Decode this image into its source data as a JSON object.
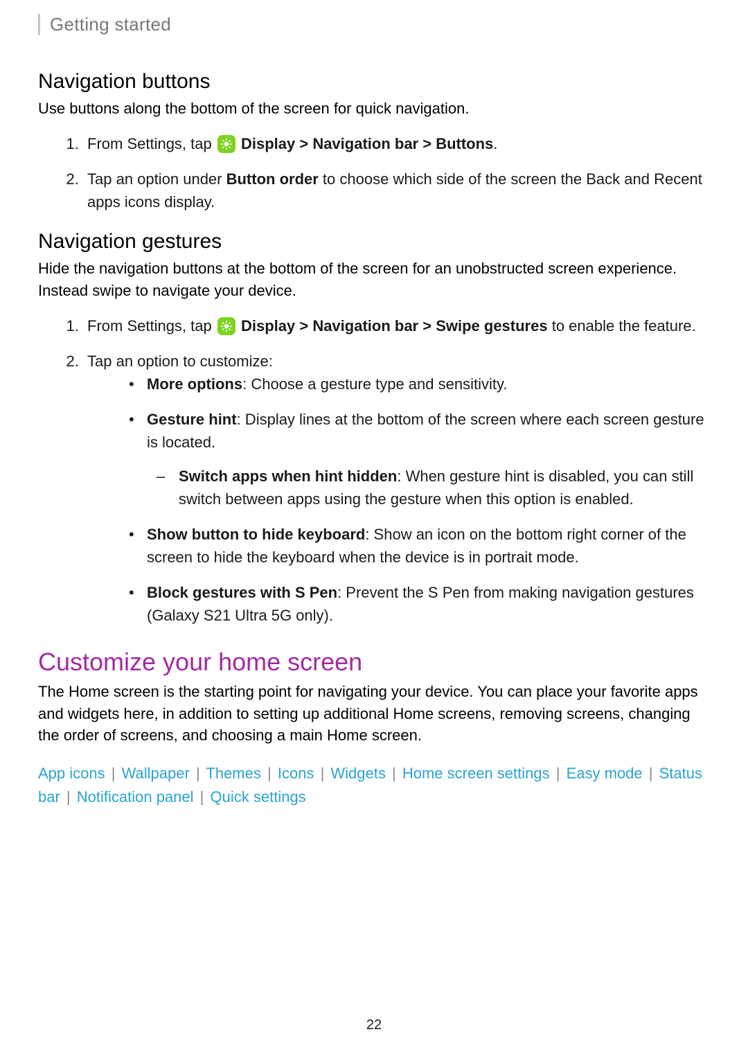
{
  "header": "Getting started",
  "nav_buttons": {
    "title": "Navigation buttons",
    "intro": "Use buttons along the bottom of the screen for quick navigation.",
    "step1_prefix": "From Settings, tap ",
    "step1_bold": "Display > Navigation bar > Buttons",
    "step1_suffix": ".",
    "step2_a": "Tap an option under ",
    "step2_bold": "Button order",
    "step2_b": " to choose which side of the screen the Back and Recent apps icons display."
  },
  "nav_gestures": {
    "title": "Navigation gestures",
    "intro": "Hide the navigation buttons at the bottom of the screen for an unobstructed screen experience. Instead swipe to navigate your device.",
    "step1_prefix": "From Settings, tap ",
    "step1_bold": "Display > Navigation bar > Swipe gestures",
    "step1_suffix": " to enable the feature.",
    "step2": "Tap an option to customize:",
    "more_options_b": "More options",
    "more_options_t": ": Choose a gesture type and sensitivity.",
    "gesture_hint_b": "Gesture hint",
    "gesture_hint_t": ": Display lines at the bottom of the screen where each screen gesture is located.",
    "switch_apps_b": "Switch apps when hint hidden",
    "switch_apps_t": ": When gesture hint is disabled, you can still switch between apps using the gesture when this option is enabled.",
    "show_button_b": "Show button to hide keyboard",
    "show_button_t": ": Show an icon on the bottom right corner of the screen to hide the keyboard when the device is in portrait mode.",
    "block_spen_b": "Block gestures with S Pen",
    "block_spen_t": ": Prevent the S Pen from making navigation gestures (Galaxy S21 Ultra 5G only)."
  },
  "customize": {
    "title": "Customize your home screen",
    "intro": "The Home screen is the starting point for navigating your device. You can place your favorite apps and widgets here, in addition to setting up additional Home screens, removing screens, changing the order of screens, and choosing a main Home screen."
  },
  "links": {
    "items": [
      "App icons",
      "Wallpaper",
      "Themes",
      "Icons",
      "Widgets",
      "Home screen settings",
      "Easy mode",
      "Status bar",
      "Notification panel",
      "Quick settings"
    ]
  },
  "page_number": "22",
  "icon_name": "display-icon"
}
